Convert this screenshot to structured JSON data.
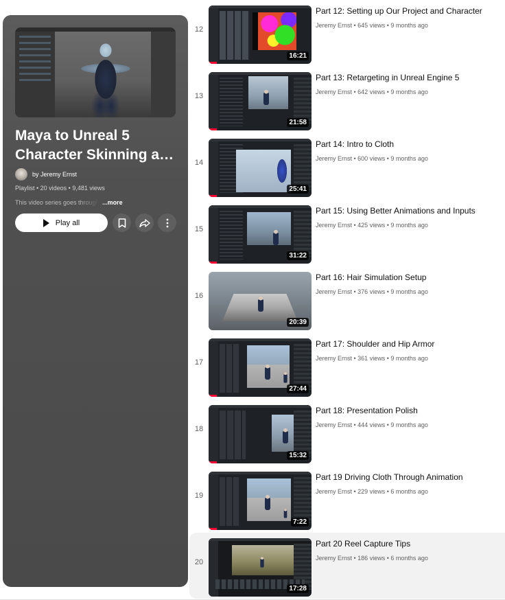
{
  "playlist": {
    "title_line1": "Maya to Unreal 5",
    "title_line2": "Character Skinning and Cloth",
    "author": "by Jeremy Ernst",
    "meta": "Playlist • 20 videos • 9,481 views",
    "description": "This video series goes through",
    "more_label": "...more",
    "play_all_label": "Play all",
    "icons": [
      "play-icon",
      "bookmark-icon",
      "share-icon",
      "more-vert-icon"
    ]
  },
  "videos": [
    {
      "index": "12",
      "title": "Part 12: Setting up Our Project and Character",
      "channel": "Jeremy Ernst",
      "views": "645 views",
      "age": "9 months ago",
      "duration": "16:21",
      "progress": 0.08
    },
    {
      "index": "13",
      "title": "Part 13: Retargeting in Unreal Engine 5",
      "channel": "Jeremy Ernst",
      "views": "642 views",
      "age": "9 months ago",
      "duration": "21:58",
      "progress": 0.08
    },
    {
      "index": "14",
      "title": "Part 14: Intro to Cloth",
      "channel": "Jeremy Ernst",
      "views": "600 views",
      "age": "9 months ago",
      "duration": "25:41",
      "progress": 0.08
    },
    {
      "index": "15",
      "title": "Part 15: Using Better Animations and Inputs",
      "channel": "Jeremy Ernst",
      "views": "425 views",
      "age": "9 months ago",
      "duration": "31:22",
      "progress": 0.08
    },
    {
      "index": "16",
      "title": "Part 16: Hair Simulation Setup",
      "channel": "Jeremy Ernst",
      "views": "376 views",
      "age": "9 months ago",
      "duration": "20:39",
      "progress": 0
    },
    {
      "index": "17",
      "title": "Part 17: Shoulder and Hip Armor",
      "channel": "Jeremy Ernst",
      "views": "361 views",
      "age": "9 months ago",
      "duration": "27:44",
      "progress": 0.08
    },
    {
      "index": "18",
      "title": "Part 18: Presentation Polish",
      "channel": "Jeremy Ernst",
      "views": "444 views",
      "age": "9 months ago",
      "duration": "15:32",
      "progress": 0.08
    },
    {
      "index": "19",
      "title": "Part 19 Driving Cloth Through Animation",
      "channel": "Jeremy Ernst",
      "views": "229 views",
      "age": "6 months ago",
      "duration": "7:22",
      "progress": 0.08
    },
    {
      "index": "20",
      "title": "Part 20 Reel Capture Tips",
      "channel": "Jeremy Ernst",
      "views": "186 views",
      "age": "6 months ago",
      "duration": "17:28",
      "progress": 0
    }
  ],
  "active_video_index": "20",
  "colors": {
    "progress": "#ff0033",
    "panel": "#4f4f4f",
    "active_row": "#f2f2f2"
  }
}
